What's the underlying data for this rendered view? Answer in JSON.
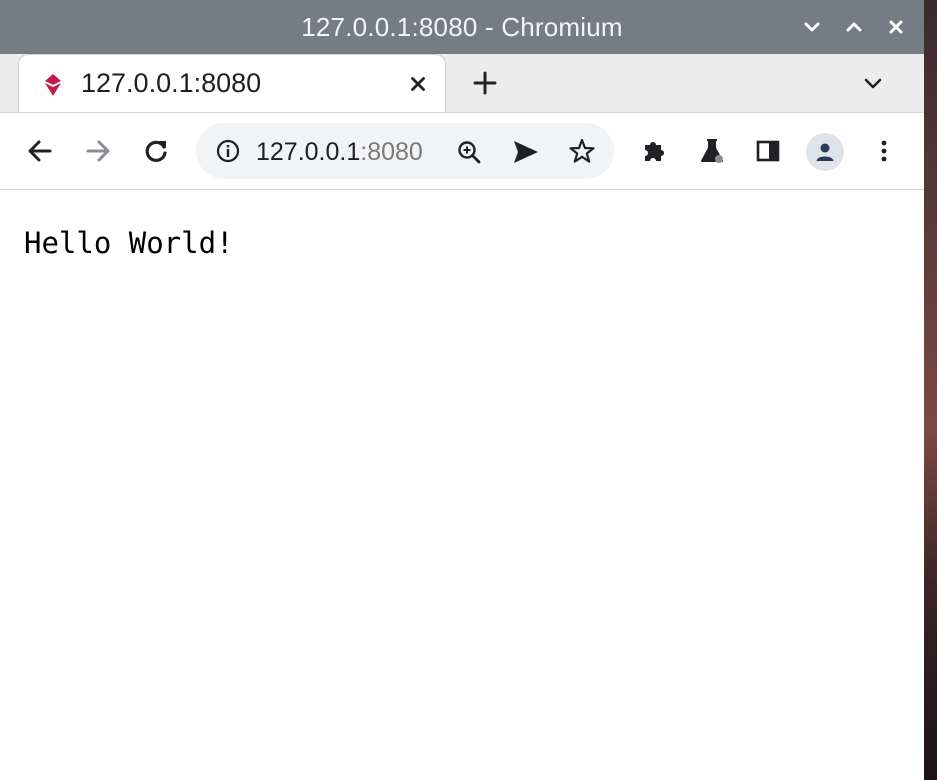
{
  "window": {
    "title": "127.0.0.1:8080 - Chromium"
  },
  "window_controls": {
    "minimize_icon": "chevron-down-icon",
    "maximize_icon": "chevron-up-icon",
    "close_icon": "close-icon"
  },
  "tabs": [
    {
      "title": "127.0.0.1:8080",
      "favicon": "raspberry-favicon-icon",
      "active": true
    }
  ],
  "address_bar": {
    "host": "127.0.0.1",
    "port": ":8080"
  },
  "page": {
    "body_text": "Hello World!"
  },
  "colors": {
    "titlebar": "#747d86",
    "tabstrip": "#ececec",
    "omnibox": "#f1f3f4",
    "favicon": "#c51a4a"
  }
}
